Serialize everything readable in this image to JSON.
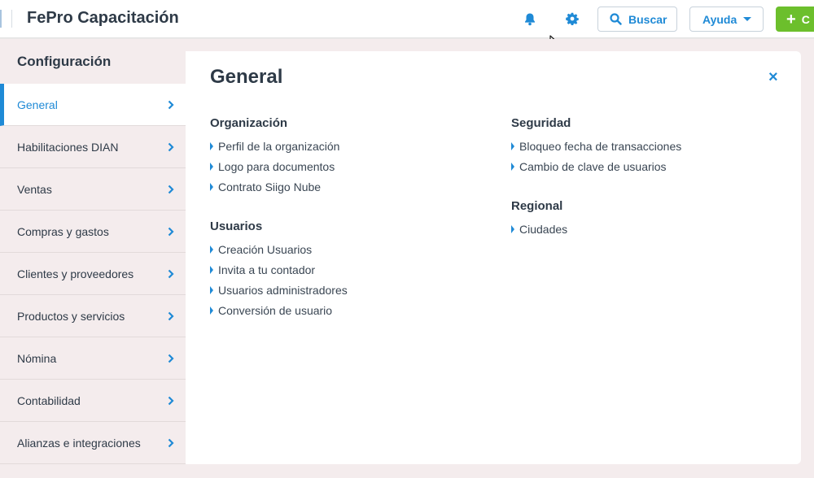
{
  "header": {
    "title": "FePro Capacitación",
    "buscar_label": "Buscar",
    "ayuda_label": "Ayuda",
    "crear_label": "C"
  },
  "sidebar": {
    "title": "Configuración",
    "items": [
      {
        "label": "General",
        "active": true
      },
      {
        "label": "Habilitaciones DIAN"
      },
      {
        "label": "Ventas"
      },
      {
        "label": "Compras y gastos"
      },
      {
        "label": "Clientes y proveedores"
      },
      {
        "label": "Productos y servicios"
      },
      {
        "label": "Nómina"
      },
      {
        "label": "Contabilidad"
      },
      {
        "label": "Alianzas e integraciones"
      }
    ]
  },
  "main": {
    "title": "General",
    "close_icon": "×",
    "sections": {
      "organizacion": {
        "title": "Organización",
        "links": [
          "Perfil de la organización",
          "Logo para documentos",
          "Contrato Siigo Nube"
        ]
      },
      "usuarios": {
        "title": "Usuarios",
        "links": [
          "Creación Usuarios",
          "Invita a tu contador",
          "Usuarios administradores",
          "Conversión de usuario"
        ]
      },
      "seguridad": {
        "title": "Seguridad",
        "links": [
          "Bloqueo fecha de transacciones",
          "Cambio de clave de usuarios"
        ]
      },
      "regional": {
        "title": "Regional",
        "links": [
          "Ciudades"
        ]
      }
    }
  },
  "colors": {
    "accent": "#1f8ad6",
    "success": "#6cbf2c",
    "panel_bg": "#f4eced",
    "text": "#2e3a47"
  },
  "icons": [
    "bell-icon",
    "gear-icon",
    "search-icon",
    "chevron-right-icon",
    "caret-right-icon",
    "close-icon",
    "plus-icon",
    "mouse-pointer-icon"
  ]
}
